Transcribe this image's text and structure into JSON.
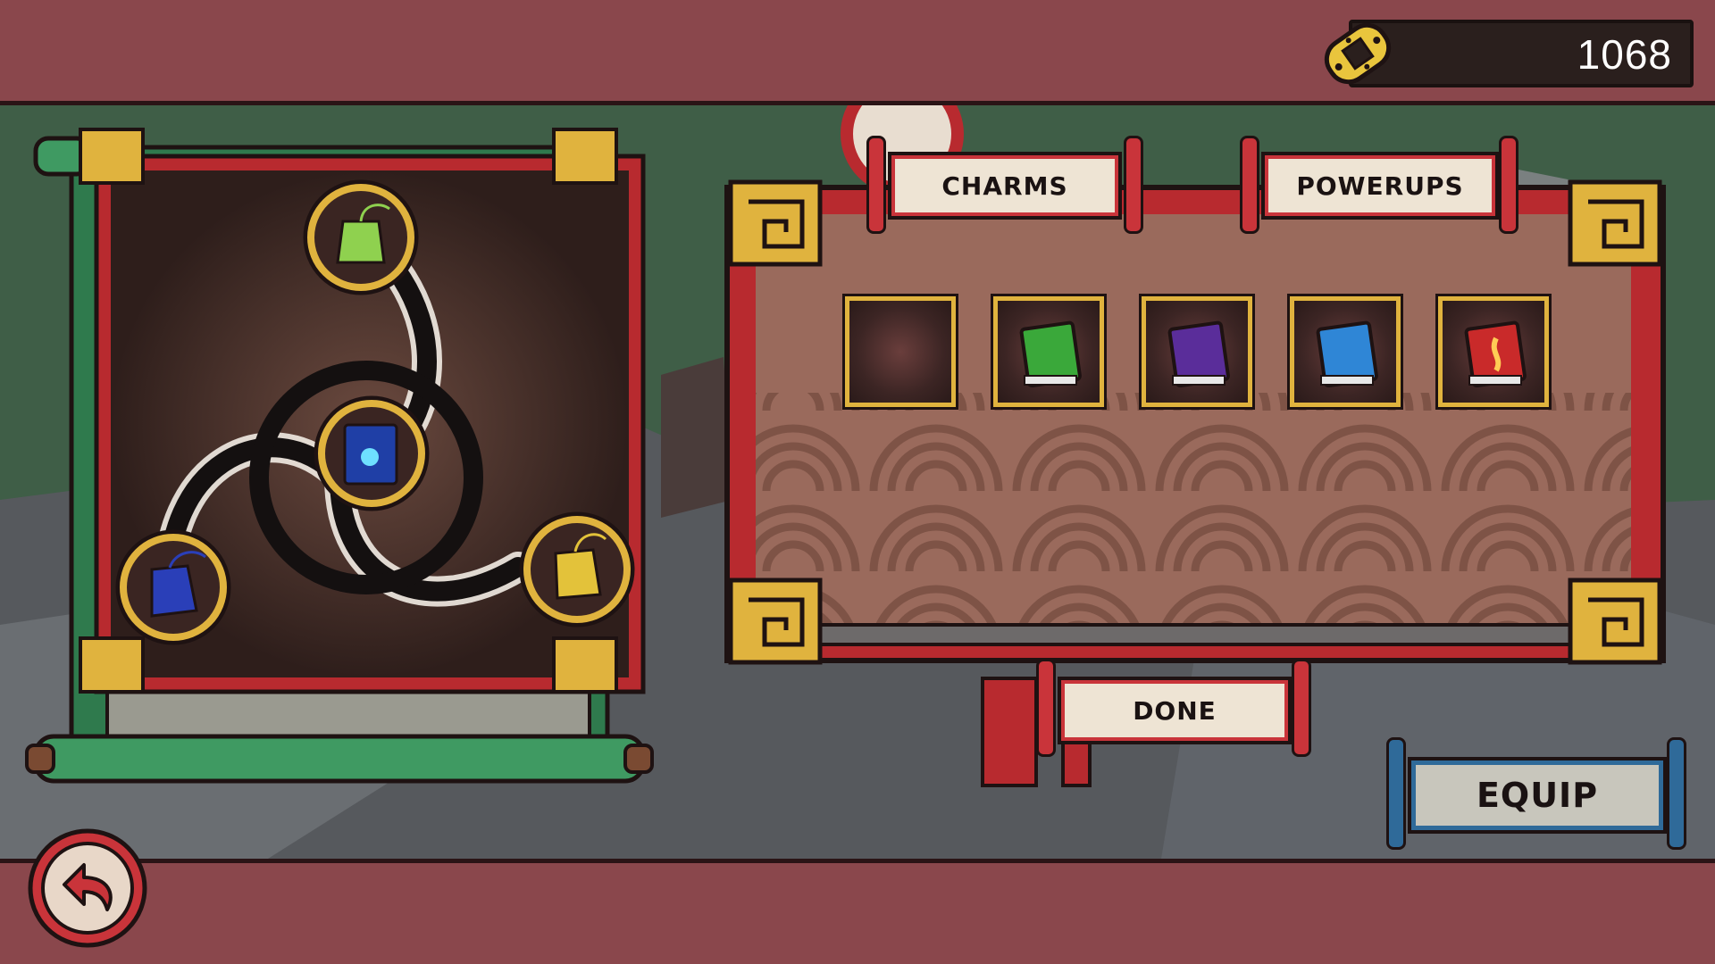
{
  "header": {
    "currency_value": "1068",
    "currency_icon": "coin-icon"
  },
  "tabs": [
    {
      "label": "CHARMS",
      "active": false
    },
    {
      "label": "POWERUPS",
      "active": true
    }
  ],
  "inventory": {
    "slots": [
      {
        "item": "empty",
        "color": ""
      },
      {
        "item": "green-spellbook",
        "color": "#3aa83a"
      },
      {
        "item": "purple-spellbook",
        "color": "#5a2d9a"
      },
      {
        "item": "blue-spellbook",
        "color": "#2f86d6"
      },
      {
        "item": "red-spellbook",
        "color": "#c92a2a"
      }
    ]
  },
  "loadout": {
    "slots": [
      {
        "item": "green-charm",
        "color": "#8fd14f"
      },
      {
        "item": "blue-spellbook",
        "color": "#1f3fa6"
      },
      {
        "item": "blue-charm",
        "color": "#2a3fb8"
      },
      {
        "item": "yellow-charm",
        "color": "#e3c23a"
      }
    ]
  },
  "buttons": {
    "done_label": "DONE",
    "equip_label": "EQUIP",
    "back_icon": "back-arrow-icon"
  },
  "colors": {
    "bar": "#8a474c",
    "gold": "#e0b33e",
    "scroll_red": "#c9343a",
    "equip_blue": "#2f6a99"
  }
}
